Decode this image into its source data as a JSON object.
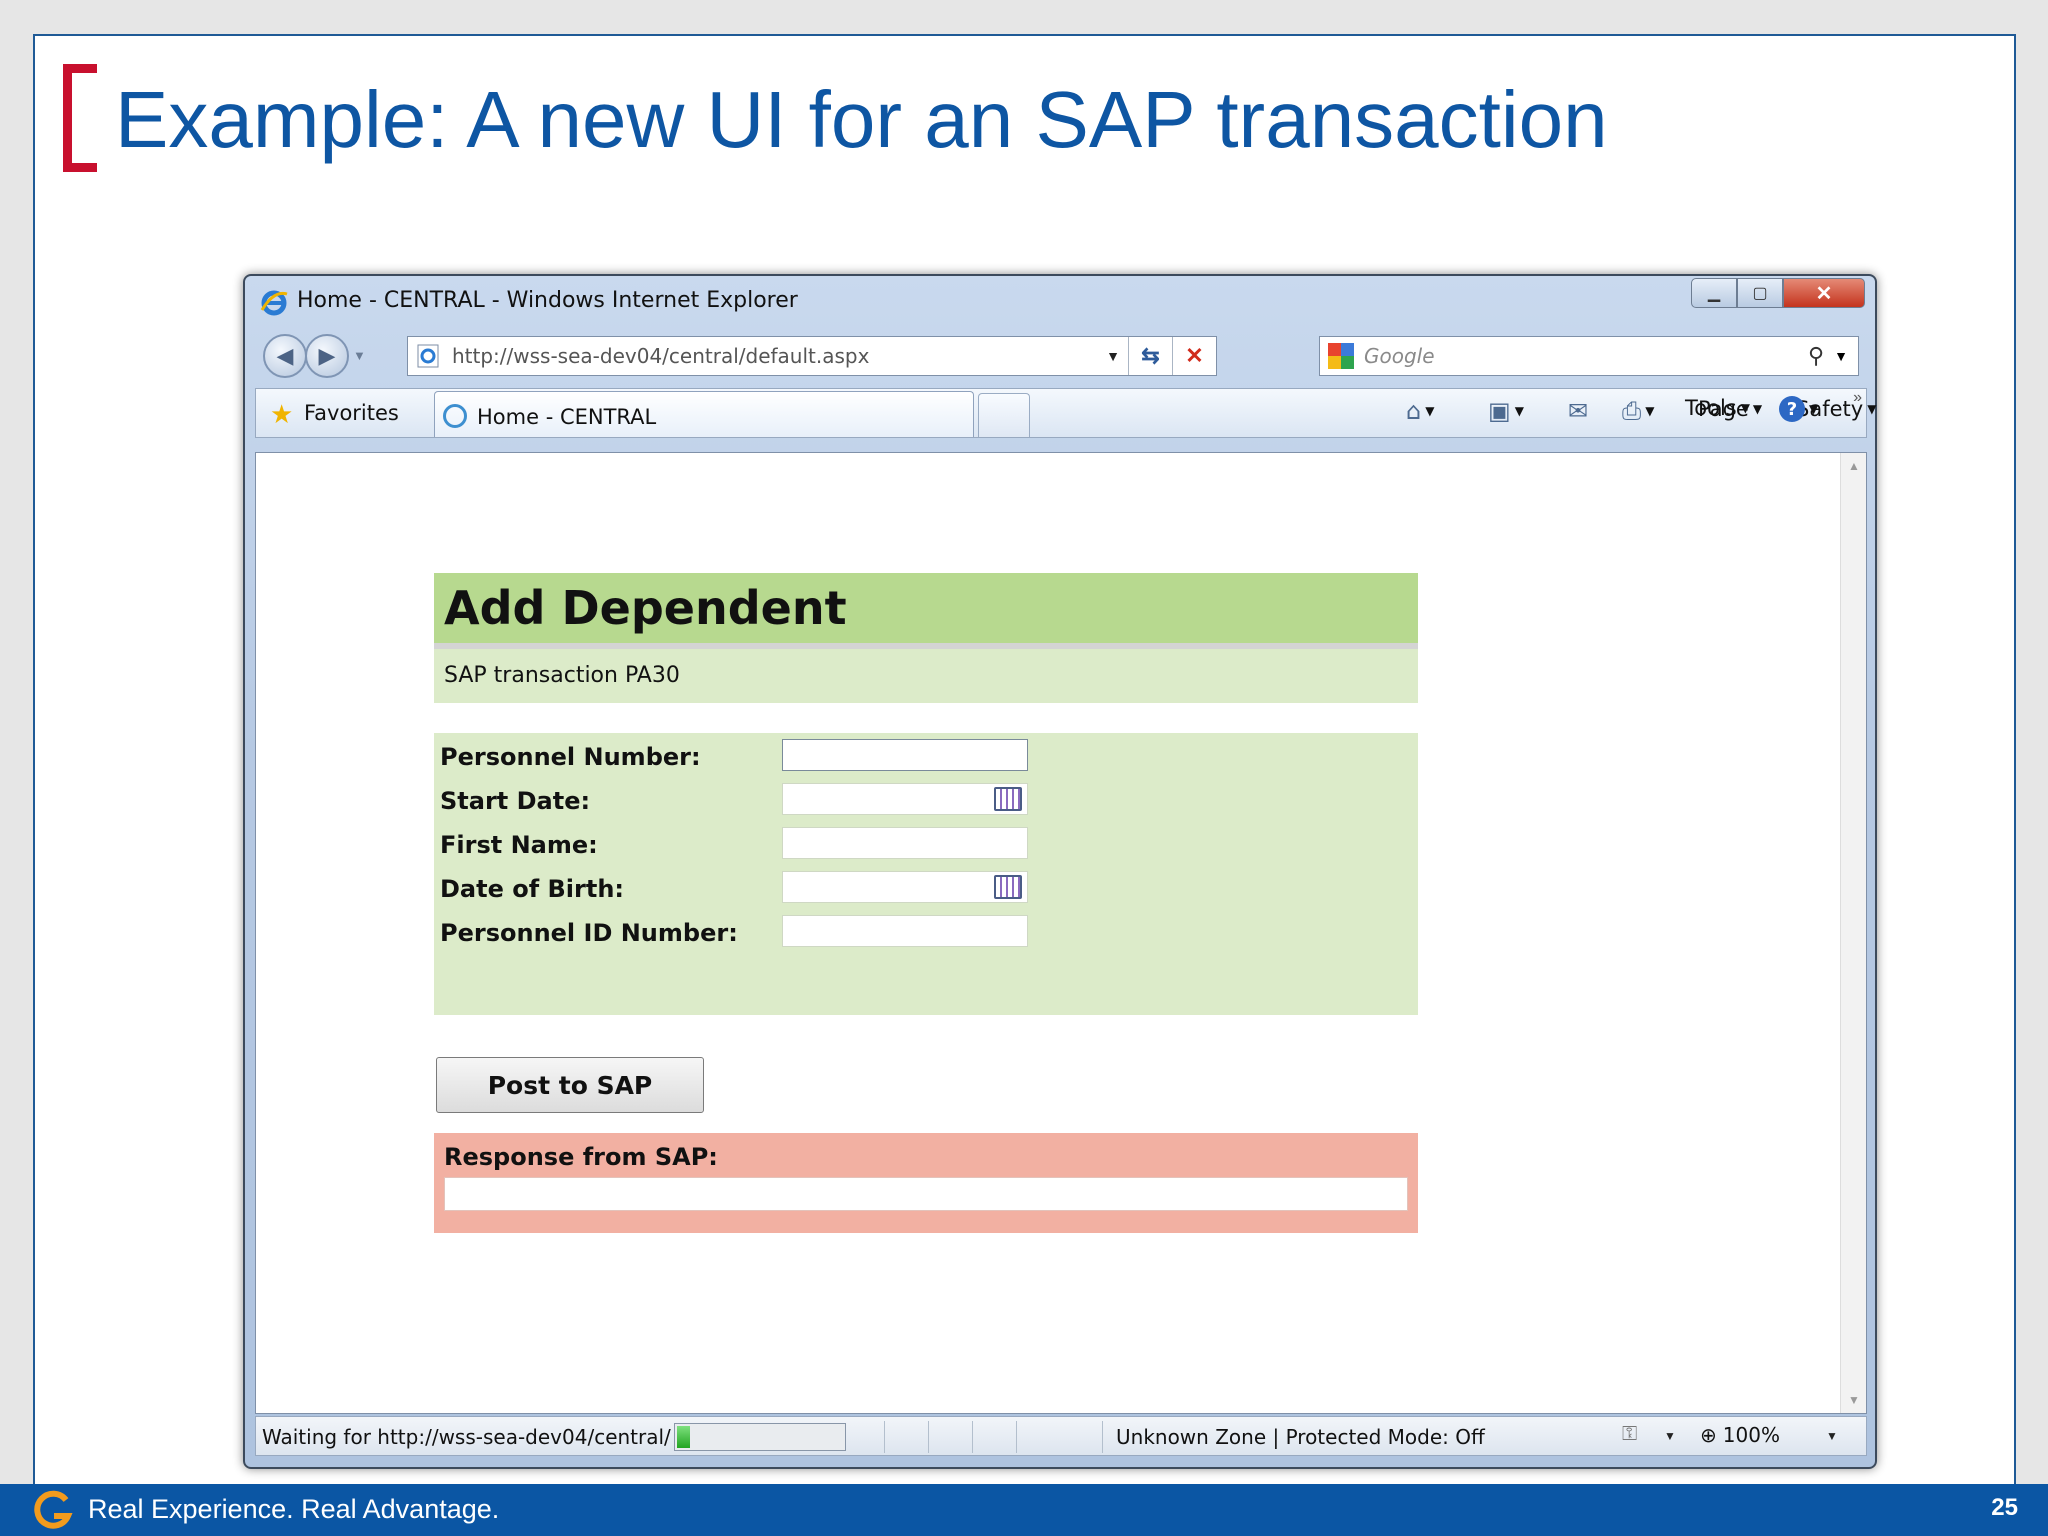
{
  "slide": {
    "title": "Example: A new UI for an SAP transaction",
    "footer_tagline": "Real Experience. Real Advantage.",
    "page_number": "25",
    "accent_color": "#c8102e",
    "brand_color": "#0b56a4"
  },
  "browser": {
    "window_title": "Home - CENTRAL - Windows Internet Explorer",
    "address": "http://wss-sea-dev04/central/default.aspx",
    "search_placeholder": "Google",
    "favorites_label": "Favorites",
    "tab_label": "Home - CENTRAL",
    "commands": {
      "page": "Page",
      "safety": "Safety",
      "tools": "Tools"
    },
    "icons": [
      "ie-logo-icon",
      "back-icon",
      "forward-icon",
      "refresh-icon",
      "stop-icon",
      "search-icon",
      "favorites-star-icon",
      "home-icon",
      "feeds-icon",
      "read-mail-icon",
      "print-icon",
      "help-icon"
    ]
  },
  "form": {
    "title": "Add Dependent",
    "subtitle": "SAP transaction PA30",
    "fields": [
      {
        "label": "Personnel Number:",
        "value": "",
        "calendar": false
      },
      {
        "label": "Start Date:",
        "value": "",
        "calendar": true
      },
      {
        "label": "First Name:",
        "value": "",
        "calendar": false
      },
      {
        "label": "Date of Birth:",
        "value": "",
        "calendar": true
      },
      {
        "label": "Personnel ID Number:",
        "value": "",
        "calendar": false
      }
    ],
    "post_button": "Post to SAP",
    "response_label": "Response from SAP:",
    "response_value": "",
    "header_color": "#b7d98f",
    "body_color": "#dcebc9",
    "response_color": "#f2b0a2"
  },
  "status": {
    "text": "Waiting for http://wss-sea-dev04/central/",
    "progress": 0.08,
    "zone": "Unknown Zone | Protected Mode: Off",
    "zoom": "100%"
  }
}
